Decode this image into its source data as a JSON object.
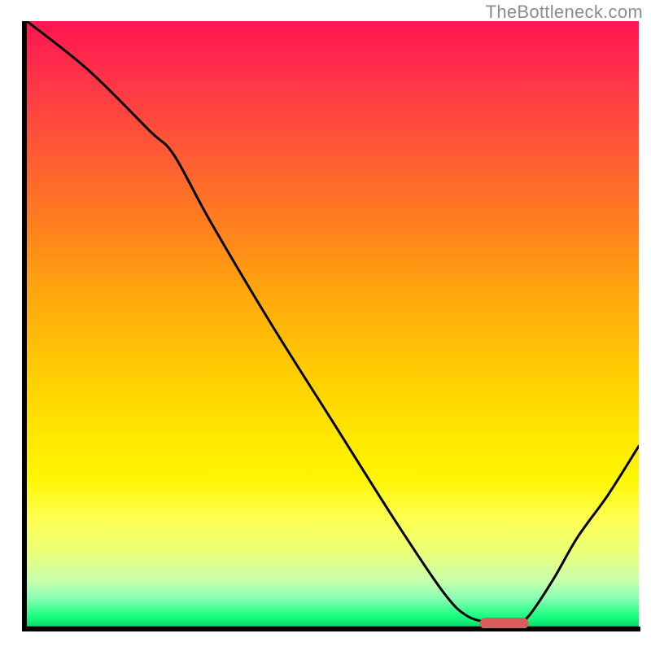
{
  "watermark": "TheBottleneck.com",
  "chart_data": {
    "type": "line",
    "title": "",
    "xlabel": "",
    "ylabel": "",
    "xlim": [
      0,
      100
    ],
    "ylim": [
      0,
      100
    ],
    "gradient_stops": [
      {
        "pct": 0,
        "color": "#ff1452"
      },
      {
        "pct": 8,
        "color": "#ff2f4a"
      },
      {
        "pct": 20,
        "color": "#ff5537"
      },
      {
        "pct": 33,
        "color": "#ff7d1f"
      },
      {
        "pct": 45,
        "color": "#ffa80c"
      },
      {
        "pct": 62,
        "color": "#ffd800"
      },
      {
        "pct": 75,
        "color": "#fff600"
      },
      {
        "pct": 82,
        "color": "#ffff52"
      },
      {
        "pct": 87,
        "color": "#ecff72"
      },
      {
        "pct": 92,
        "color": "#caffac"
      },
      {
        "pct": 95,
        "color": "#8cffb4"
      },
      {
        "pct": 98,
        "color": "#1aff80"
      },
      {
        "pct": 100,
        "color": "#07d864"
      }
    ],
    "series": [
      {
        "name": "bottleneck-curve",
        "x": [
          0,
          10,
          20,
          24,
          30,
          40,
          50,
          60,
          68,
          72,
          76,
          80,
          82,
          86,
          90,
          95,
          100
        ],
        "y": [
          100,
          92,
          82,
          78,
          67,
          50,
          34,
          18,
          6,
          2,
          1,
          1,
          2,
          8,
          15,
          22,
          30
        ]
      }
    ],
    "marker": {
      "name": "optimum-range",
      "x_start": 74,
      "x_end": 82,
      "y": 0.8,
      "color": "#d85d5d"
    }
  }
}
